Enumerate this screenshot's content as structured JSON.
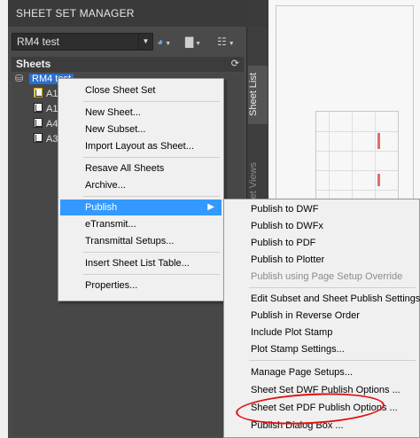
{
  "palette": {
    "title": "SHEET SET MANAGER",
    "set_name": "RM4 test",
    "sheets_header": "Sheets",
    "tree": {
      "root": "RM4 test",
      "sheets": [
        "A1",
        "A1",
        "A4",
        "A3"
      ]
    },
    "tabs": [
      "Sheet List",
      "Sheet Views"
    ]
  },
  "context_menu": {
    "items": [
      "Close Sheet Set",
      "New Sheet...",
      "New Subset...",
      "Import Layout as Sheet...",
      "Resave All Sheets",
      "Archive...",
      "Publish",
      "eTransmit...",
      "Transmittal Setups...",
      "Insert Sheet List Table...",
      "Properties..."
    ],
    "highlighted": "Publish"
  },
  "publish_submenu": {
    "items": [
      "Publish to DWF",
      "Publish to DWFx",
      "Publish to PDF",
      "Publish to Plotter",
      "Publish using Page Setup Override",
      "Edit Subset and Sheet Publish Settings...",
      "Publish in Reverse Order",
      "Include Plot Stamp",
      "Plot Stamp Settings...",
      "Manage Page Setups...",
      "Sheet Set DWF Publish Options ...",
      "Sheet Set PDF Publish Options ...",
      "Publish Dialog Box ..."
    ],
    "disabled": "Publish using Page Setup Override",
    "circled": "Sheet Set PDF Publish Options ..."
  },
  "colors": {
    "selection": "#2a6fd0",
    "menu_highlight": "#3399ff",
    "annotation_circle": "#e01010"
  }
}
